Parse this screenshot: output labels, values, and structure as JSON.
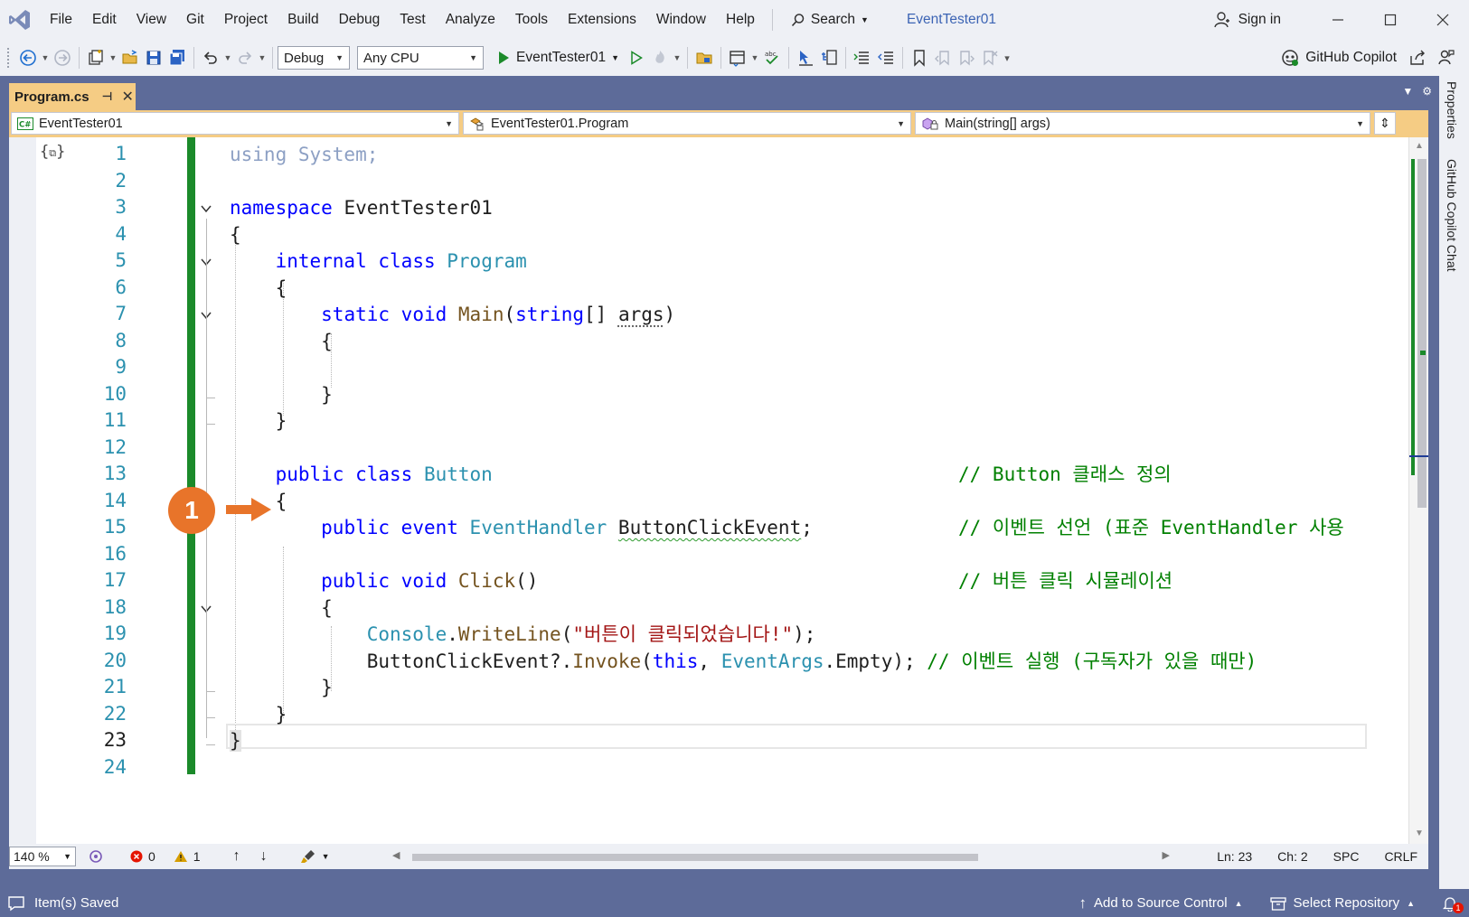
{
  "menu": {
    "items": [
      "File",
      "Edit",
      "View",
      "Git",
      "Project",
      "Build",
      "Debug",
      "Test",
      "Analyze",
      "Tools",
      "Extensions",
      "Window",
      "Help"
    ],
    "search_label": "Search",
    "solution_name": "EventTester01",
    "sign_in": "Sign in"
  },
  "toolbar": {
    "config": "Debug",
    "platform": "Any CPU",
    "run_target": "EventTester01",
    "copilot": "GitHub Copilot"
  },
  "tab": {
    "name": "Program.cs"
  },
  "navbar": {
    "project": "EventTester01",
    "type": "EventTester01.Program",
    "member": "Main(string[] args)"
  },
  "editor": {
    "current_line": 23,
    "line_numbers": [
      "1",
      "2",
      "3",
      "4",
      "5",
      "6",
      "7",
      "8",
      "9",
      "10",
      "11",
      "12",
      "13",
      "14",
      "15",
      "16",
      "17",
      "18",
      "19",
      "20",
      "21",
      "22",
      "23",
      "24"
    ],
    "callout_number": "1",
    "accent_green": "#1b8a2a",
    "callout_color": "#e8742a"
  },
  "code": {
    "l1": {
      "kw": "using",
      "rest": " System;"
    },
    "l3": {
      "kw": "namespace",
      "name": " EventTester01"
    },
    "l4": "{",
    "l5": {
      "kw1": "internal",
      "kw2": "class",
      "name": "Program"
    },
    "l6": "{",
    "l7": {
      "kw1": "static",
      "kw2": "void",
      "fn": "Main",
      "p1": "(",
      "ty": "string",
      "p2": "[] ",
      "arg": "args",
      "p3": ")"
    },
    "l8": "{",
    "l10": "}",
    "l11": "}",
    "l13": {
      "kw1": "public",
      "kw2": "class",
      "name": "Button",
      "comment": "// Button 클래스 정의"
    },
    "l14": "{",
    "l15": {
      "kw1": "public",
      "kw2": "event",
      "ty": "EventHandler",
      "name": "ButtonClickEvent",
      "semi": ";",
      "comment": "// 이벤트 선언 (표준 EventHandler 사용"
    },
    "l17": {
      "kw1": "public",
      "kw2": "void",
      "fn": "Click",
      "paren": "()",
      "comment": "// 버튼 클릭 시뮬레이션"
    },
    "l18": "{",
    "l19": {
      "ty": "Console",
      "dot": ".",
      "fn": "WriteLine",
      "p1": "(",
      "str": "\"버튼이 클릭되었습니다!\"",
      "p2": ");"
    },
    "l20": {
      "name": "ButtonClickEvent?.",
      "fn": "Invoke",
      "p1": "(",
      "kw": "this",
      "comma": ", ",
      "ty": "EventArgs",
      "rest": ".Empty);",
      "comment": " // 이벤트 실행 (구독자가 있을 때만)"
    },
    "l21": "}",
    "l22": "}",
    "l23": "}"
  },
  "editor_bar": {
    "zoom": "140 %",
    "errors": "0",
    "warnings": "1",
    "ln": "Ln: 23",
    "ch": "Ch: 2",
    "spc": "SPC",
    "crlf": "CRLF"
  },
  "side": {
    "properties": "Properties",
    "copilot_chat": "GitHub Copilot Chat"
  },
  "status": {
    "message": "Item(s) Saved",
    "source_control": "Add to Source Control",
    "repository": "Select Repository",
    "notifications": "1"
  }
}
